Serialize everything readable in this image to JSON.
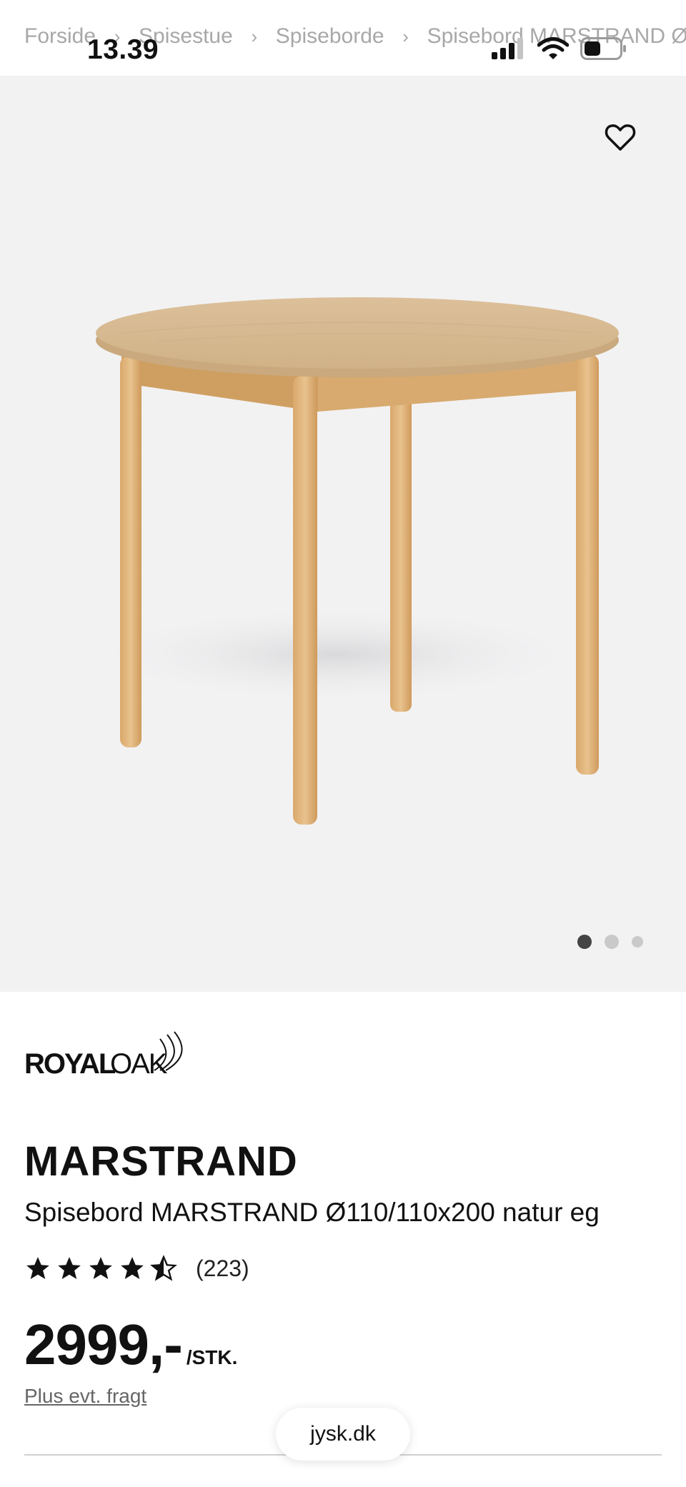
{
  "status_bar": {
    "time": "13.39"
  },
  "breadcrumb": [
    "Forside",
    "Spisestue",
    "Spiseborde",
    "Spisebord MARSTRAND Ø"
  ],
  "brand": {
    "name": "ROYALOAK"
  },
  "product": {
    "title": "MARSTRAND",
    "subtitle": "Spisebord MARSTRAND Ø110/110x200 natur eg",
    "rating": 4.5,
    "reviews": "(223)",
    "price": "2999,-",
    "unit": "/STK.",
    "freight_link": "Plus evt. fragt"
  },
  "carousel": {
    "current": 1,
    "total": 3
  },
  "browser": {
    "url": "jysk.dk"
  },
  "colors": {
    "hero_bg": "#f2f2f3",
    "wood": "#d9b98e",
    "text": "#111111"
  }
}
